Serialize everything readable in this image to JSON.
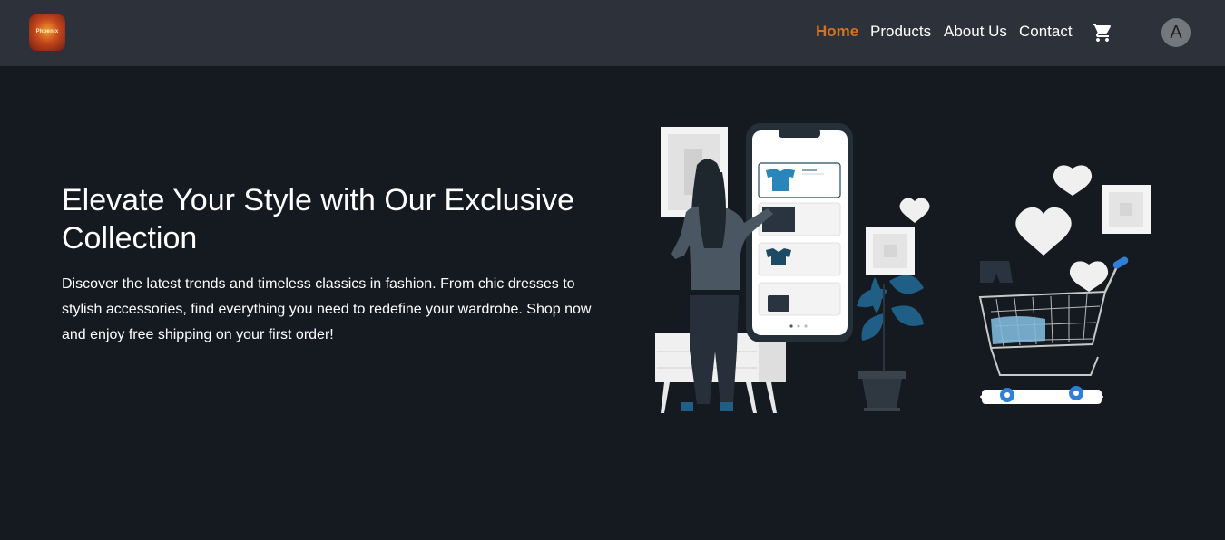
{
  "brand": {
    "logo_text": "Phoenix"
  },
  "nav": {
    "home": "Home",
    "products": "Products",
    "about": "About Us",
    "contact": "Contact",
    "avatar_initial": "A"
  },
  "hero": {
    "title": "Elevate Your Style with Our Exclusive Collection",
    "description": "Discover the latest trends and timeless classics in fashion. From chic dresses to stylish accessories, find everything you need to redefine your wardrobe. Shop now and enjoy free shipping on your first order!"
  },
  "colors": {
    "navbar_bg": "#2d3139",
    "page_bg": "#151a21",
    "accent": "#d4711f",
    "illustration_teal": "#1f5f86",
    "cart_blue": "#2f7fd8"
  },
  "icons": {
    "cart": "shopping-cart-icon",
    "avatar": "user-avatar"
  }
}
